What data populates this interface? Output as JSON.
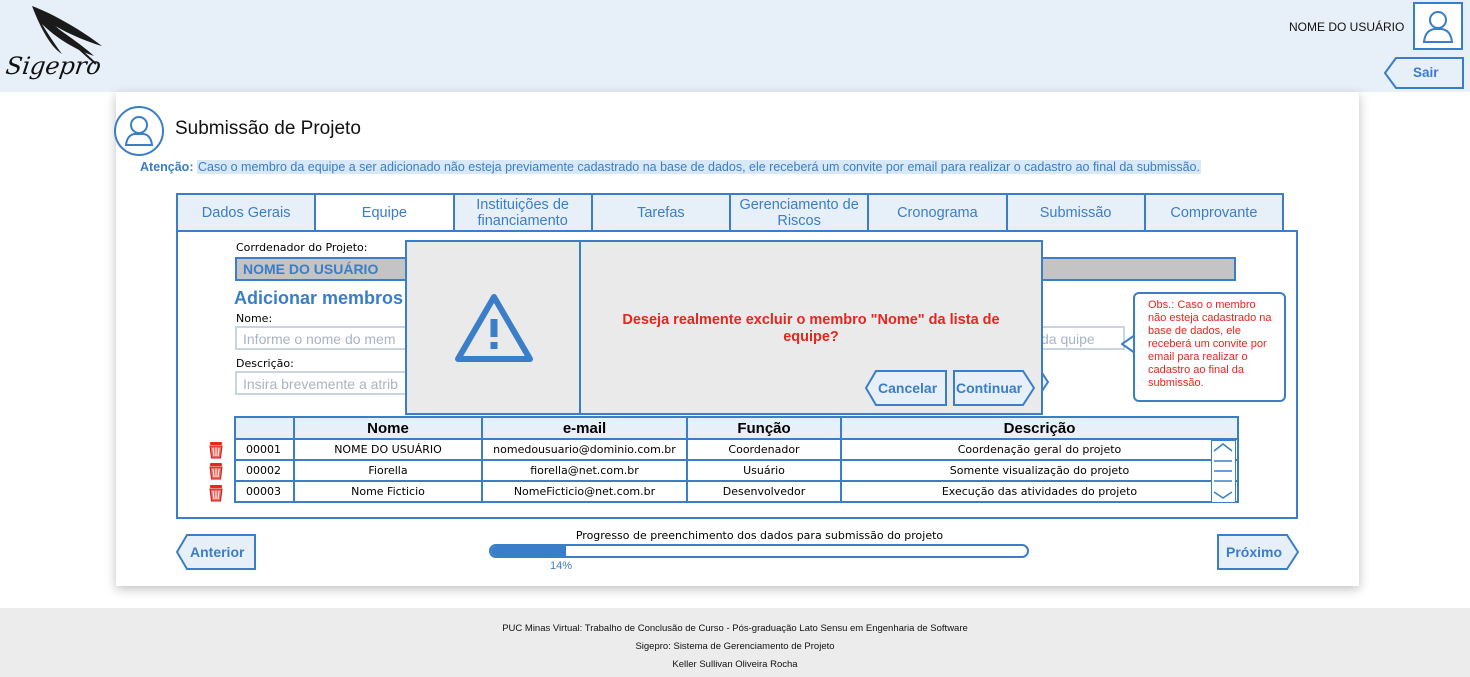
{
  "header": {
    "logo_text": "Sigepro",
    "user_name": "NOME DO USUÁRIO",
    "logout_label": "Sair"
  },
  "page": {
    "title": "Submissão de Projeto",
    "attention_label": "Atenção:",
    "attention_text": "Caso o membro da equipe a ser adicionado não esteja previamente cadastrado na base de dados, ele receberá um convite por email para realizar o cadastro ao final da submissão."
  },
  "tabs": [
    {
      "label": "Dados Gerais"
    },
    {
      "label": "Equipe",
      "active": true
    },
    {
      "label": "Instituições de financiamento"
    },
    {
      "label": "Tarefas"
    },
    {
      "label": "Gerenciamento de Riscos"
    },
    {
      "label": "Cronograma"
    },
    {
      "label": "Submissão"
    },
    {
      "label": "Comprovante"
    }
  ],
  "form": {
    "coordinator_label": "Corrdenador do Projeto:",
    "coordinator_value": "NOME DO USUÁRIO",
    "add_heading": "Adicionar membros",
    "name_label": "Nome:",
    "name_placeholder_visible": "Informe o nome do mem",
    "name_placeholder_tail": "da quipe",
    "desc_label": "Descrição:",
    "desc_placeholder_visible": "Insira brevemente a atrib"
  },
  "obs_note": "Obs.: Caso o membro não esteja cadastrado na base de dados, ele receberá um convite por email para realizar o cadastro ao final da submissão.",
  "table": {
    "headers": [
      "",
      "Nome",
      "e-mail",
      "Função",
      "Descrição"
    ],
    "rows": [
      {
        "id": "00001",
        "name": "NOME DO USUÁRIO",
        "email": "nomedousuario@dominio.com.br",
        "role": "Coordenador",
        "desc": "Coordenação geral do projeto"
      },
      {
        "id": "00002",
        "name": "Fiorella",
        "email": "fiorella@net.com.br",
        "role": "Usuário",
        "desc": "Somente visualização do projeto"
      },
      {
        "id": "00003",
        "name": "Nome Ficticio",
        "email": "NomeFicticio@net.com.br",
        "role": "Desenvolvedor",
        "desc": "Execução das atividades do projeto"
      }
    ]
  },
  "navigation": {
    "prev_label": "Anterior",
    "next_label": "Próximo",
    "progress_label": "Progresso de preenchimento dos dados para submissão do projeto",
    "progress_text": "14%",
    "progress_fraction": 0.14
  },
  "modal": {
    "message": "Deseja realmente excluir o membro \"Nome\" da lista de equipe?",
    "cancel_label": "Cancelar",
    "confirm_label": "Continuar"
  },
  "footer": {
    "line1": "PUC Minas Virtual: Trabalho de Conclusão de Curso - Pós-graduação Lato Sensu em Engenharia de Software",
    "line2": "Sigepro: Sistema de Gerenciamento de Projeto",
    "line3": "Keller Sullivan Oliveira Rocha"
  },
  "colors": {
    "accent": "#3a7dc9",
    "header_bg": "#e7f0f9",
    "warning_text": "#e8251f",
    "modal_bg": "#eaeaea",
    "footer_bg": "#ececec"
  },
  "icons": [
    "quill-logo-icon",
    "user-avatar-icon",
    "logout-arrow-icon",
    "warning-triangle-icon",
    "trash-icon",
    "scroll-up-icon",
    "scroll-down-icon"
  ]
}
